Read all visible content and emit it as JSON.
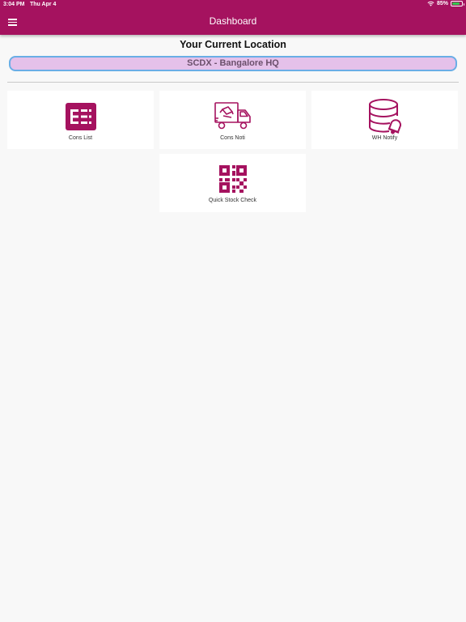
{
  "status_bar": {
    "time": "3:04 PM",
    "date": "Thu Apr 4",
    "battery": "85%",
    "battery_level": 0.85
  },
  "header": {
    "title": "Dashboard"
  },
  "location": {
    "heading": "Your Current Location",
    "value": "SCDX - Bangalore HQ"
  },
  "tiles": [
    {
      "label": "Cons List",
      "icon": "list-icon"
    },
    {
      "label": "Cons Noti",
      "icon": "delivery-truck-icon"
    },
    {
      "label": "WH Notify",
      "icon": "database-bell-icon"
    },
    {
      "label": "Quick Stock Check",
      "icon": "qr-code-icon"
    }
  ],
  "colors": {
    "brand": "#a5125f",
    "background": "#f8f8f8",
    "location_fill": "#e5c1ea",
    "location_border": "#6aaee6"
  }
}
